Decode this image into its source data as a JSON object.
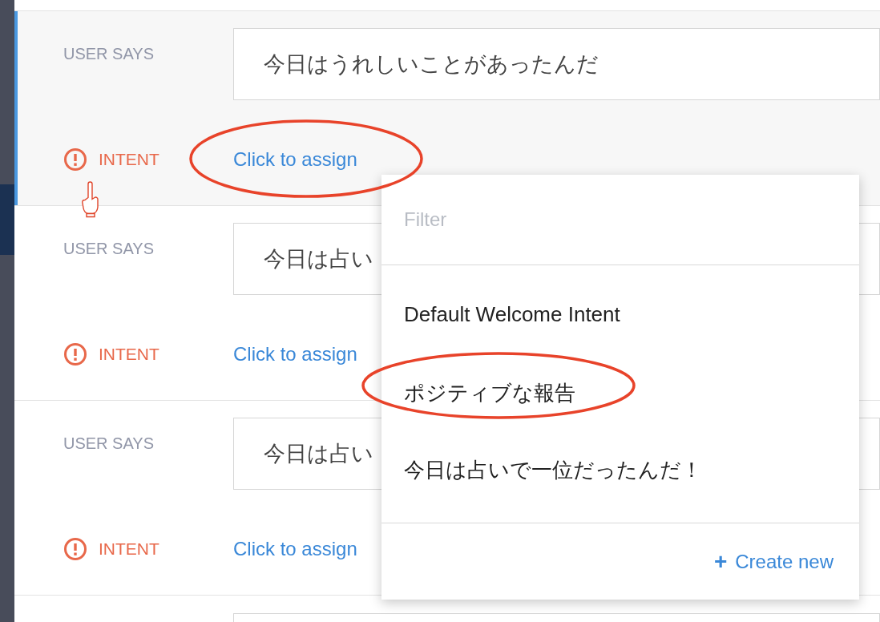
{
  "rows": [
    {
      "label": "USER SAYS",
      "phrase": "今日はうれしいことがあったんだ",
      "intent_label": "INTENT",
      "assign": "Click to assign",
      "selected": true
    },
    {
      "label": "USER SAYS",
      "phrase": "今日は占い",
      "intent_label": "INTENT",
      "assign": "Click to assign",
      "selected": false
    },
    {
      "label": "USER SAYS",
      "phrase": "今日は占い",
      "intent_label": "INTENT",
      "assign": "Click to assign",
      "selected": false
    }
  ],
  "dropdown": {
    "placeholder": "Filter",
    "items": [
      {
        "label": "Default Welcome Intent",
        "highlighted": false
      },
      {
        "label": "ポジティブな報告",
        "highlighted": true
      },
      {
        "label": "今日は占いで一位だったんだ！",
        "highlighted": false
      }
    ],
    "create": {
      "icon": "+",
      "label": "Create new"
    }
  }
}
